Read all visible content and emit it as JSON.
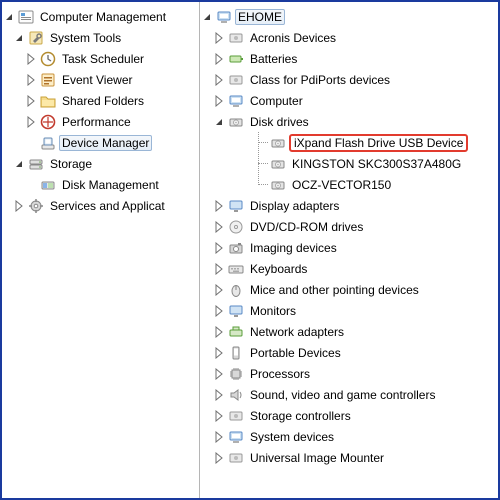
{
  "left": {
    "root": "Computer Management",
    "system_tools": "System Tools",
    "task_scheduler": "Task Scheduler",
    "event_viewer": "Event Viewer",
    "shared_folders": "Shared Folders",
    "performance": "Performance",
    "device_manager": "Device Manager",
    "storage": "Storage",
    "disk_management": "Disk Management",
    "services": "Services and Applicat"
  },
  "right": {
    "root": "EHOME",
    "acronis": "Acronis Devices",
    "batteries": "Batteries",
    "pdiports": "Class for PdiPorts devices",
    "computer": "Computer",
    "disk_drives": "Disk drives",
    "ixpand": "iXpand Flash Drive USB Device",
    "kingston": "KINGSTON SKC300S37A480G",
    "ocz": "OCZ-VECTOR150",
    "display": "Display adapters",
    "dvd": "DVD/CD-ROM drives",
    "imaging": "Imaging devices",
    "keyboards": "Keyboards",
    "mice": "Mice and other pointing devices",
    "monitors": "Monitors",
    "network": "Network adapters",
    "portable": "Portable Devices",
    "processors": "Processors",
    "sound": "Sound, video and game controllers",
    "storage_ctrl": "Storage controllers",
    "system_dev": "System devices",
    "uim": "Universal Image Mounter"
  }
}
